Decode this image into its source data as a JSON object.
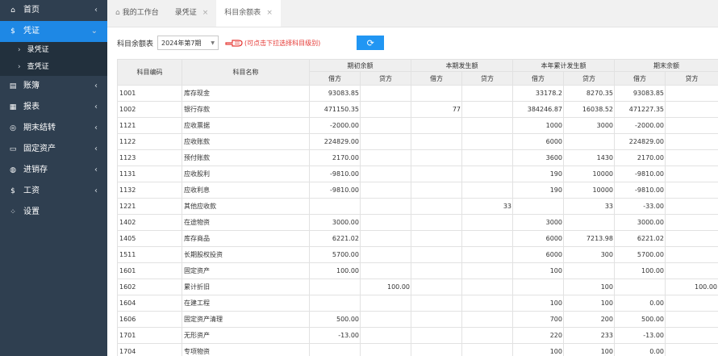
{
  "sidebar": {
    "items": [
      {
        "key": "home",
        "label": "首页",
        "icon": "home-icon",
        "chev": "‹"
      },
      {
        "key": "voucher",
        "label": "凭证",
        "icon": "dollar-icon",
        "chev": "⌄",
        "active": true
      },
      {
        "key": "ledger",
        "label": "账簿",
        "icon": "book-icon",
        "chev": "‹"
      },
      {
        "key": "report",
        "label": "报表",
        "icon": "report-icon",
        "chev": "‹"
      },
      {
        "key": "closing",
        "label": "期末结转",
        "icon": "closing-icon",
        "chev": "‹"
      },
      {
        "key": "assets",
        "label": "固定资产",
        "icon": "assets-icon",
        "chev": "‹"
      },
      {
        "key": "inventory",
        "label": "进销存",
        "icon": "inventory-icon",
        "chev": "‹"
      },
      {
        "key": "salary",
        "label": "工资",
        "icon": "salary-icon",
        "chev": "‹"
      },
      {
        "key": "settings",
        "label": "设置",
        "icon": "settings-icon",
        "chev": ""
      }
    ],
    "voucher_sub": [
      {
        "label": "录凭证"
      },
      {
        "label": "查凭证"
      }
    ]
  },
  "tabs": [
    {
      "label": "我的工作台",
      "closable": false
    },
    {
      "label": "录凭证",
      "closable": true
    },
    {
      "label": "科目余额表",
      "closable": true,
      "active": true
    }
  ],
  "toolbar": {
    "label": "科目余额表",
    "period": "2024年第7期",
    "hint": "(可点击下拉选择科目级别)"
  },
  "table": {
    "head1": [
      "科目编码",
      "科目名称",
      "期初余额",
      "本期发生额",
      "本年累计发生额",
      "期末余额"
    ],
    "head2": [
      "借方",
      "贷方",
      "借方",
      "贷方",
      "借方",
      "贷方",
      "借方",
      "贷方"
    ],
    "rows": [
      {
        "code": "1001",
        "name": "库存现金",
        "v": [
          "93083.85",
          "",
          "",
          "",
          "33178.2",
          "8270.35",
          "93083.85",
          ""
        ]
      },
      {
        "code": "1002",
        "name": "银行存款",
        "v": [
          "471150.35",
          "",
          "77",
          "",
          "384246.87",
          "16038.52",
          "471227.35",
          ""
        ]
      },
      {
        "code": "1121",
        "name": "应收票据",
        "v": [
          "-2000.00",
          "",
          "",
          "",
          "1000",
          "3000",
          "-2000.00",
          ""
        ]
      },
      {
        "code": "1122",
        "name": "应收账款",
        "v": [
          "224829.00",
          "",
          "",
          "",
          "6000",
          "",
          "224829.00",
          ""
        ]
      },
      {
        "code": "1123",
        "name": "预付账款",
        "v": [
          "2170.00",
          "",
          "",
          "",
          "3600",
          "1430",
          "2170.00",
          ""
        ]
      },
      {
        "code": "1131",
        "name": "应收股利",
        "v": [
          "-9810.00",
          "",
          "",
          "",
          "190",
          "10000",
          "-9810.00",
          ""
        ]
      },
      {
        "code": "1132",
        "name": "应收利息",
        "v": [
          "-9810.00",
          "",
          "",
          "",
          "190",
          "10000",
          "-9810.00",
          ""
        ]
      },
      {
        "code": "1221",
        "name": "其他应收款",
        "v": [
          "",
          "",
          "",
          "33",
          "",
          "33",
          "-33.00",
          ""
        ]
      },
      {
        "code": "1402",
        "name": "在途物资",
        "v": [
          "3000.00",
          "",
          "",
          "",
          "3000",
          "",
          "3000.00",
          ""
        ]
      },
      {
        "code": "1405",
        "name": "库存商品",
        "v": [
          "6221.02",
          "",
          "",
          "",
          "6000",
          "7213.98",
          "6221.02",
          ""
        ]
      },
      {
        "code": "1511",
        "name": "长期股权投资",
        "v": [
          "5700.00",
          "",
          "",
          "",
          "6000",
          "300",
          "5700.00",
          ""
        ]
      },
      {
        "code": "1601",
        "name": "固定资产",
        "v": [
          "100.00",
          "",
          "",
          "",
          "100",
          "",
          "100.00",
          ""
        ]
      },
      {
        "code": "1602",
        "name": "累计折旧",
        "v": [
          "",
          "100.00",
          "",
          "",
          "",
          "100",
          "",
          "100.00"
        ]
      },
      {
        "code": "1604",
        "name": "在建工程",
        "v": [
          "",
          "",
          "",
          "",
          "100",
          "100",
          "0.00",
          ""
        ]
      },
      {
        "code": "1606",
        "name": "固定资产清理",
        "v": [
          "500.00",
          "",
          "",
          "",
          "700",
          "200",
          "500.00",
          ""
        ]
      },
      {
        "code": "1701",
        "name": "无形资产",
        "v": [
          "-13.00",
          "",
          "",
          "",
          "220",
          "233",
          "-13.00",
          ""
        ]
      },
      {
        "code": "1704",
        "name": "专项物资",
        "v": [
          "",
          "",
          "",
          "",
          "100",
          "100",
          "0.00",
          ""
        ]
      }
    ]
  },
  "colors": {
    "sidebar_bg": "#2f3f50",
    "active_blue": "#1e88e5",
    "hint_red": "#e53935",
    "button_blue": "#2196f3"
  }
}
